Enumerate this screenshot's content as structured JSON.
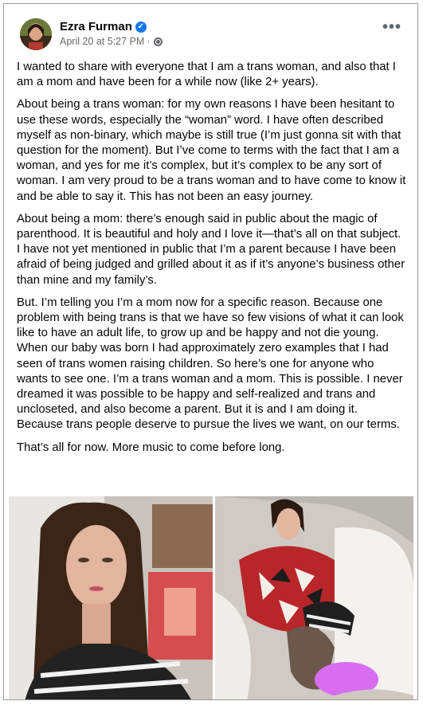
{
  "post": {
    "author": "Ezra Furman",
    "timestamp": "April 20 at 5:27 PM",
    "separator": "·",
    "verified_badge": "✓",
    "more_label": "•••",
    "paragraphs": [
      "I wanted to share with everyone that I am a trans woman, and also that I am a mom and have been for a while now (like 2+ years).",
      "About being a trans woman: for my own reasons I have been hesitant to use these words, especially the “woman” word. I have often described myself as non-binary, which maybe is still true (I’m just gonna sit with that question for the moment). But I’ve come to terms with the fact that I am a woman, and yes for me it’s complex, but it’s complex to be any sort of woman. I am very proud to be a trans woman and to have come to know it and be able to say it. This has not been an easy journey.",
      "About being a mom: there’s enough said in public about the magic of parenthood. It is beautiful and holy and I love it—that’s all on that subject. I have not yet mentioned in public that I’m a parent because I have been afraid of being judged and grilled about it as if it’s anyone’s business other than mine and my family’s.",
      "But. I’m telling you I’m a mom now for a specific reason. Because one problem with being trans is that we have so few visions of what it can look like to have an adult life, to grow up and be happy and not die young. When our baby was born I had approximately zero examples that I had seen of trans women raising children. So here’s one for anyone who wants to see one. I’m a trans woman and a mom. This is possible. I never dreamed it was possible to be happy and self-realized and trans and uncloseted, and also become a parent. But it is and I am doing it. Because trans people deserve to pursue the lives we want, on our terms.",
      "That’s all for now. More music to come before long."
    ]
  },
  "colors": {
    "text": "#050505",
    "meta": "#65676b",
    "verified": "#1877f2",
    "blur_patch": "#d86df0"
  },
  "icons": [
    "verified-badge-icon",
    "globe-icon",
    "more-options-icon"
  ]
}
